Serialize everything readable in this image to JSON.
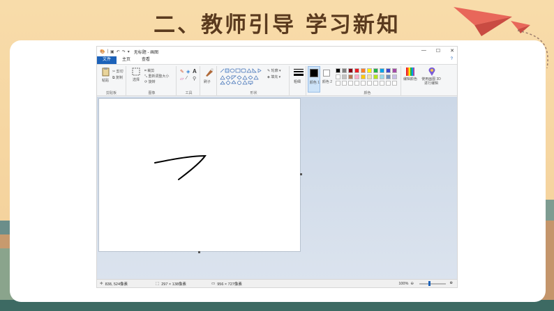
{
  "slide": {
    "title": "二、教师引导 学习新知"
  },
  "paint": {
    "window_title": "无标题 - 画图",
    "window_controls": {
      "minimize": "—",
      "maximize": "☐",
      "close": "✕"
    },
    "tabs": [
      {
        "label": "文件"
      },
      {
        "label": "主页"
      },
      {
        "label": "查看"
      }
    ],
    "help_icon": "?",
    "ribbon": {
      "clipboard": {
        "label": "剪贴板",
        "paste": "粘贴",
        "cut": "剪切",
        "copy": "复制"
      },
      "image": {
        "label": "图像",
        "select": "选择",
        "crop": "裁剪",
        "resize": "重新调整大小",
        "rotate": "旋转"
      },
      "tools": {
        "label": "工具"
      },
      "brushes": {
        "label": "刷子"
      },
      "shapes": {
        "label": "形状",
        "outline": "轮廓",
        "fill": "填充"
      },
      "size": {
        "label": "粗细"
      },
      "color1": {
        "label": "颜色 1"
      },
      "color2": {
        "label": "颜色 2"
      },
      "colors": {
        "label": "颜色"
      },
      "edit_colors": {
        "label": "编辑颜色"
      },
      "paint3d": {
        "label": "使用画图 3D 进行编辑"
      }
    },
    "palette": {
      "row1": [
        "#000000",
        "#7f7f7f",
        "#880015",
        "#ed1c24",
        "#ff7f27",
        "#fff200",
        "#22b14c",
        "#00a2e8",
        "#3f48cc",
        "#a349a4"
      ],
      "row2": [
        "#ffffff",
        "#c3c3c3",
        "#b97a57",
        "#ffaec9",
        "#ffc90e",
        "#efe4b0",
        "#b5e61d",
        "#99d9ea",
        "#7092be",
        "#c8bfe7"
      ],
      "row3": [
        "#ffffff",
        "#ffffff",
        "#ffffff",
        "#ffffff",
        "#ffffff",
        "#ffffff",
        "#ffffff",
        "#ffffff",
        "#ffffff",
        "#ffffff"
      ]
    },
    "status": {
      "cursor_pos": "838, 524像素",
      "selection_size": "297 × 138像素",
      "image_size": "956 × 727像素",
      "zoom": "100%"
    }
  }
}
